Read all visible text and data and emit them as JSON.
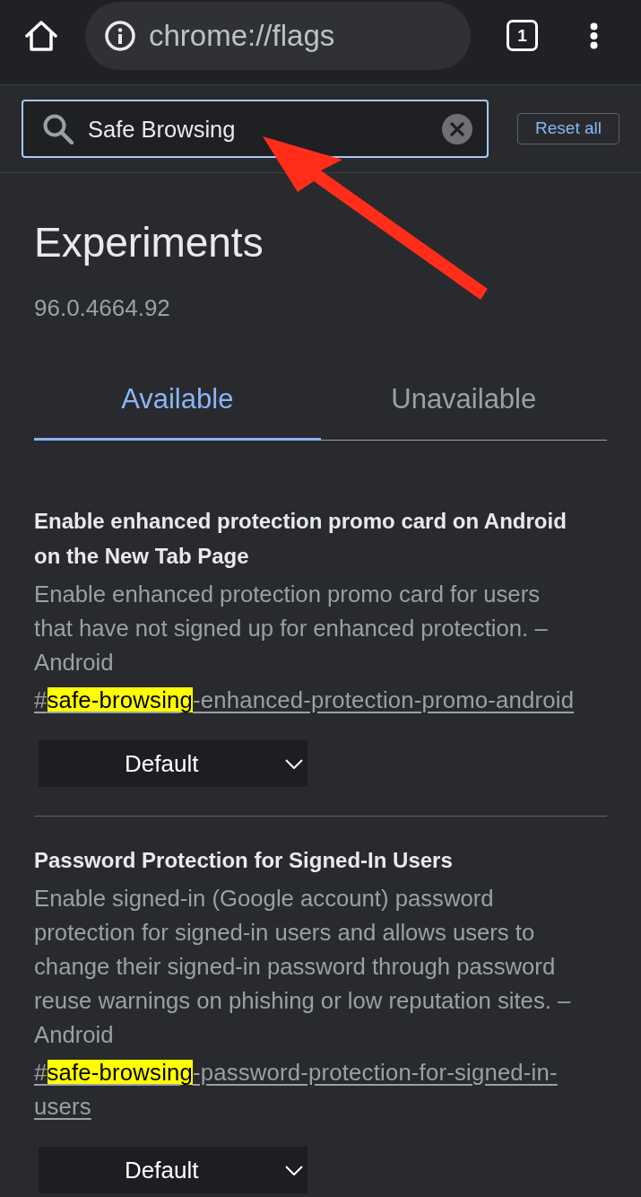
{
  "toolbar": {
    "url": "chrome://flags",
    "tab_count": "1"
  },
  "search": {
    "value": "Safe Browsing",
    "reset_button": "Reset all"
  },
  "page": {
    "title": "Experiments",
    "version": "96.0.4664.92"
  },
  "tabs": [
    {
      "label": "Available",
      "selected": true
    },
    {
      "label": "Unavailable",
      "selected": false
    }
  ],
  "flags": [
    {
      "title": "Enable enhanced protection promo card on Android on the New Tab Page",
      "description": "Enable enhanced protection promo card for users that have not signed up for enhanced protection. – Android",
      "link": [
        {
          "text": "#",
          "highlighted": false
        },
        {
          "text": "safe-browsing",
          "highlighted": true
        },
        {
          "text": "-enhanced-protection-promo-android",
          "highlighted": false
        }
      ],
      "select": "Default"
    },
    {
      "title": "Password Protection for Signed-In Users",
      "description": "Enable signed-in (Google account) password protection for signed-in users and allows users to change their signed-in password through password reuse warnings on phishing or low reputation sites. – Android",
      "link": [
        {
          "text": "#",
          "highlighted": false
        },
        {
          "text": "safe-browsing",
          "highlighted": true
        },
        {
          "text": "-password-protection-for-signed-in-users",
          "highlighted": false
        }
      ],
      "select": "Default"
    }
  ],
  "annotations": [
    {
      "kind": "arrow"
    }
  ]
}
